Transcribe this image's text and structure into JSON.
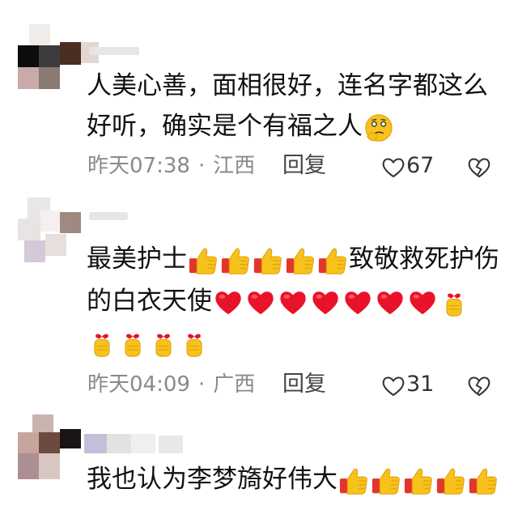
{
  "comments": [
    {
      "lines": [
        "人美心善，面相很好，连名字都这么",
        "好听，确实是个有福之人"
      ],
      "time": "昨天07:38",
      "region": "江西",
      "reply_label": "回复",
      "likes": "67"
    },
    {
      "lines": [
        "最美护士",
        "致敬救死护伤",
        "的白衣天使"
      ],
      "time": "昨天04:09",
      "region": "广西",
      "reply_label": "回复",
      "likes": "31"
    },
    {
      "lines": [
        "我也认为李梦旖好伟大"
      ]
    }
  ],
  "separator": "·",
  "icons": {
    "like": "heart-outline-icon",
    "dislike": "broken-heart-icon",
    "emojis": [
      "thinking-face-icon",
      "thumbs-up-icon",
      "red-heart-icon",
      "finger-heart-icon"
    ]
  },
  "colors": {
    "meta": "#8a8a8a",
    "heart": "#e8132b",
    "thumb": "#f5b81c"
  }
}
